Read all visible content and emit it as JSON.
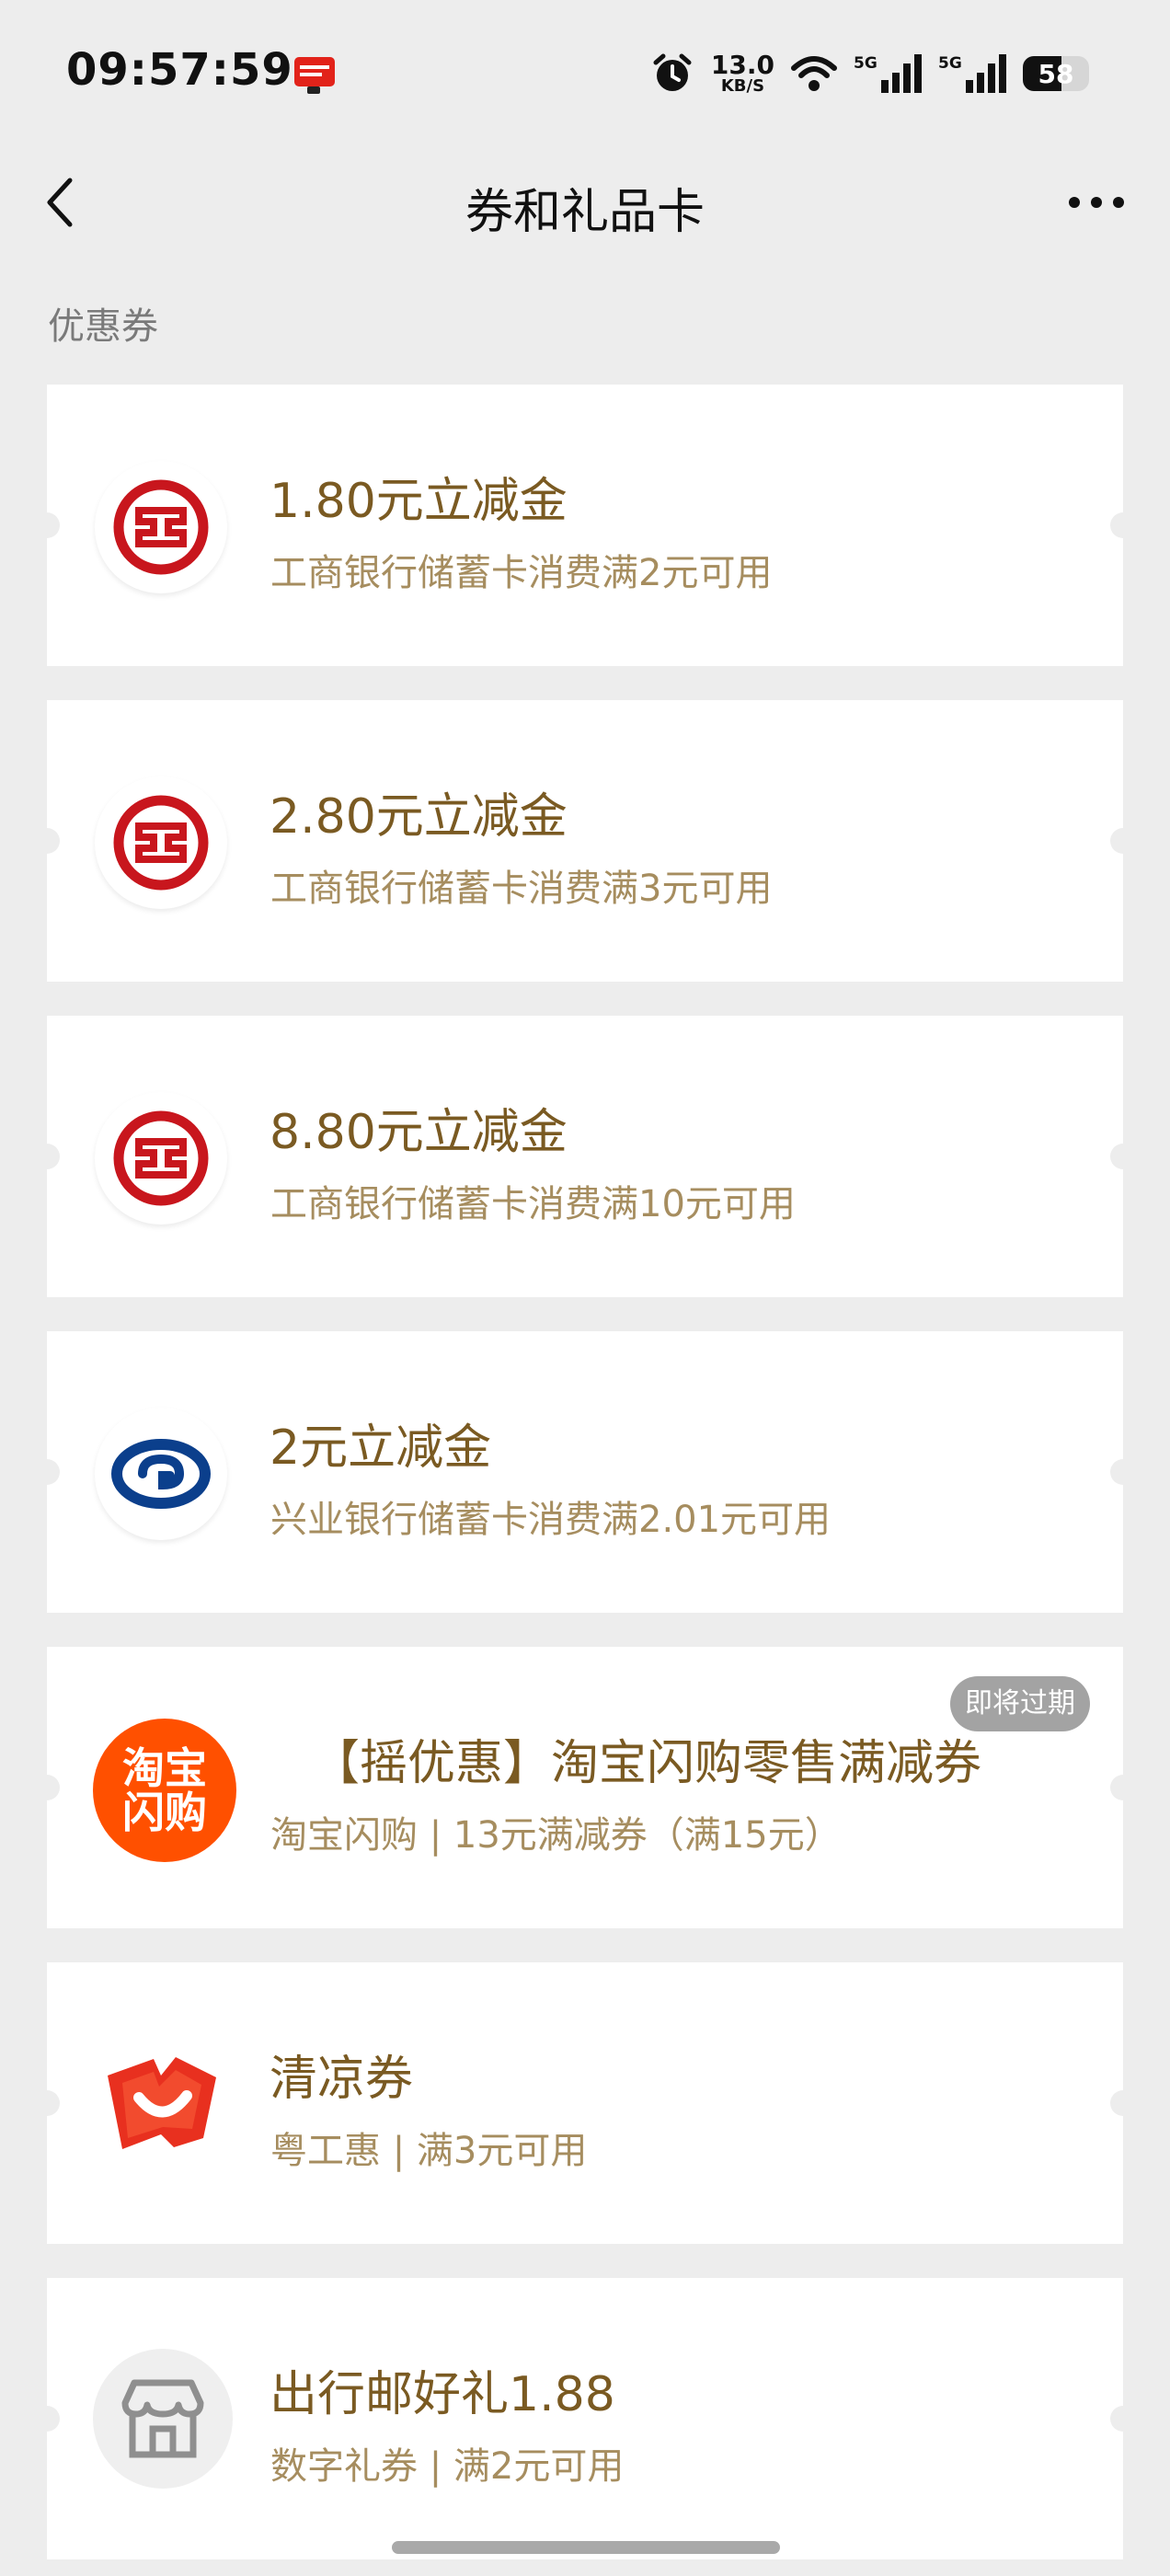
{
  "status_bar": {
    "time": "09:57:59",
    "net_speed": "13.0",
    "net_unit": "KB/S",
    "battery": 58,
    "battery_label": "58"
  },
  "nav": {
    "title": "券和礼品卡"
  },
  "section": {
    "label": "优惠券"
  },
  "coupons": [
    {
      "title": "1.80元立减金",
      "desc": "工商银行储蓄卡消费满2元可用",
      "logo": "icbc-logo-icon"
    },
    {
      "title": "2.80元立减金",
      "desc": "工商银行储蓄卡消费满3元可用",
      "logo": "icbc-logo-icon"
    },
    {
      "title": "8.80元立减金",
      "desc": "工商银行储蓄卡消费满10元可用",
      "logo": "icbc-logo-icon"
    },
    {
      "title": "2元立减金",
      "desc": "兴业银行储蓄卡消费满2.01元可用",
      "logo": "cib-logo-icon"
    },
    {
      "title": "【摇优惠】淘宝闪购零售满减券",
      "desc": "淘宝闪购 | 13元满减券（满15元）",
      "logo": "taobao-flash-logo-icon",
      "badge": "即将过期",
      "logo_text_1": "淘宝",
      "logo_text_2": "闪购"
    },
    {
      "title": "清凉券",
      "desc": "粤工惠 | 满3元可用",
      "logo": "yuegonghui-logo-icon"
    },
    {
      "title": "出行邮好礼1.88",
      "desc": "数字礼券 | 满2元可用",
      "logo": "store-icon"
    }
  ],
  "colors": {
    "title": "#7a5a22",
    "desc": "#a68d5f",
    "icbc_red": "#c8161d",
    "cib_blue": "#0b3f8c",
    "taobao_orange": "#ff5000",
    "badge_grey": "#a3a3a3"
  }
}
